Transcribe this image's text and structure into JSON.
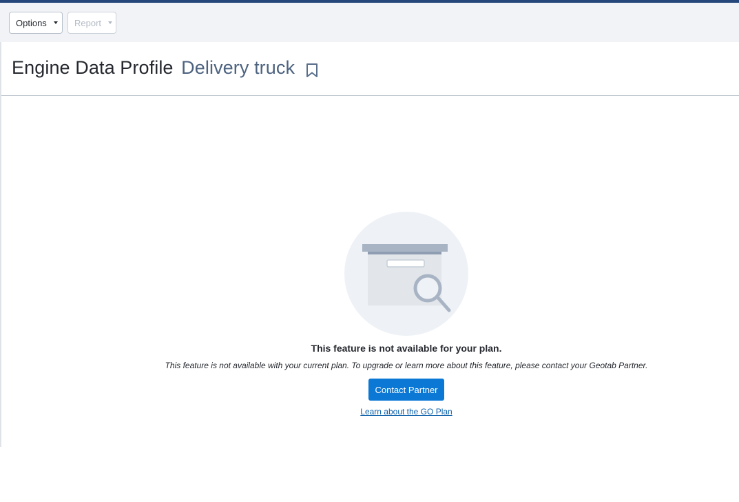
{
  "toolbar": {
    "options_label": "Options",
    "report_label": "Report"
  },
  "header": {
    "title": "Engine Data Profile",
    "subtitle": "Delivery truck",
    "bookmark_icon": "bookmark-icon"
  },
  "empty_state": {
    "illustration_icon": "archive-box-magnifier-icon",
    "title": "This feature is not available for your plan.",
    "message": "This feature is not available with your current plan. To upgrade or learn more about this feature, please contact your Geotab Partner.",
    "contact_button_label": "Contact Partner",
    "learn_link_label": "Learn about the GO Plan"
  },
  "colors": {
    "top_strip": "#25477b",
    "toolbar_bg": "#f1f3f6",
    "primary_button": "#0a78d4",
    "link": "#0b5fa8",
    "subtitle": "#4d6380"
  }
}
